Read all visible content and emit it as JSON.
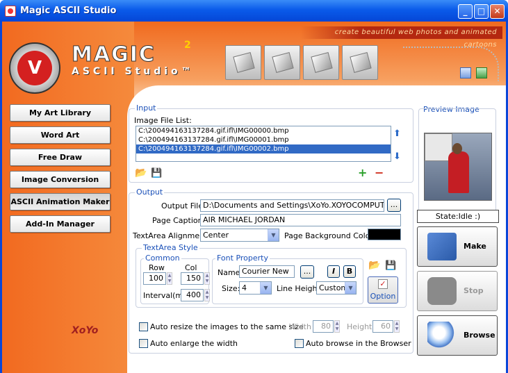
{
  "window": {
    "title": "Magic ASCII Studio",
    "min": "_",
    "max": "□",
    "close": "✕"
  },
  "header": {
    "slogan": "create beautiful web photos and animated cartoons",
    "logo_main": "MAGIC",
    "logo_sup": "2",
    "logo_sub": "ASCII Studio™",
    "toolbar_icons": [
      "tool-icon-1",
      "tool-icon-2",
      "tool-icon-3",
      "tool-icon-4"
    ]
  },
  "sidebar": {
    "items": [
      {
        "label": "My Art Library"
      },
      {
        "label": "Word Art"
      },
      {
        "label": "Free Draw"
      },
      {
        "label": "Image Conversion"
      },
      {
        "label": "ASCII Animation Maker",
        "active": true
      },
      {
        "label": "Add-In Manager"
      }
    ]
  },
  "input": {
    "group_label": "Input",
    "list_label": "Image File List:",
    "files": [
      "C:\\200494163137284.gif.ifl\\IMG00000.bmp",
      "C:\\200494163137284.gif.ifl\\IMG00001.bmp",
      "C:\\200494163137284.gif.ifl\\IMG00002.bmp"
    ],
    "selected_index": 2
  },
  "output": {
    "group_label": "Output",
    "file_label": "Output File:",
    "file_value": "D:\\Documents and Settings\\XoYo.XOYOCOMPUTER\\",
    "browse_label": "...",
    "caption_label": "Page Caption:",
    "caption_value": "AIR MICHAEL JORDAN",
    "align_label": "TextArea Alignment:",
    "align_value": "Center",
    "bg_label": "Page Background Color:",
    "bg_color": "#000000",
    "style_label": "TextArea Style",
    "common_label": "Common",
    "row_label": "Row",
    "row_value": "100",
    "col_label": "Col",
    "col_value": "150",
    "interval_label": "Interval(ms)",
    "interval_value": "400",
    "font_label": "Font Property",
    "name_label": "Name:",
    "name_value": "Courier New",
    "name_btn": "...",
    "italic_btn": "I",
    "bold_btn": "B",
    "size_label": "Size:",
    "size_value": "4",
    "lineheight_label": "Line Height:",
    "lineheight_value": "Custom",
    "option_label": "Option"
  },
  "options": {
    "auto_resize": "Auto resize the images to the same size",
    "width_label": "Width",
    "width_value": "80",
    "height_label": "Height",
    "height_value": "60",
    "auto_enlarge": "Auto enlarge the width",
    "auto_browse": "Auto browse in the Browser"
  },
  "right": {
    "preview_label": "Preview Image",
    "state": "State:Idle :)",
    "make": "Make",
    "stop": "Stop",
    "browse": "Browse"
  },
  "footer": {
    "brand": "XoYo"
  }
}
